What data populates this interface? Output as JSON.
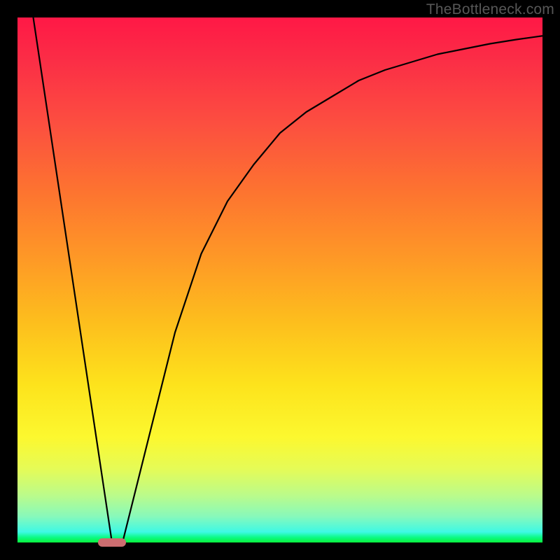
{
  "watermark": "TheBottleneck.com",
  "chart_data": {
    "type": "line",
    "title": "",
    "xlabel": "",
    "ylabel": "",
    "xlim": [
      0,
      100
    ],
    "ylim": [
      0,
      100
    ],
    "grid": false,
    "series": [
      {
        "name": "bottleneck-curve",
        "x": [
          3,
          18,
          20,
          25,
          30,
          35,
          40,
          45,
          50,
          55,
          60,
          65,
          70,
          75,
          80,
          85,
          90,
          95,
          100
        ],
        "values": [
          100,
          0,
          0,
          20,
          40,
          55,
          65,
          72,
          78,
          82,
          85,
          88,
          90,
          91.5,
          93,
          94,
          95,
          95.8,
          96.5
        ]
      }
    ],
    "marker": {
      "x": 18,
      "y": 0,
      "color": "#cc6d70"
    },
    "background_gradient": {
      "top": "#ff1846",
      "mid": "#fde31c",
      "bottom": "#09f33b"
    }
  }
}
